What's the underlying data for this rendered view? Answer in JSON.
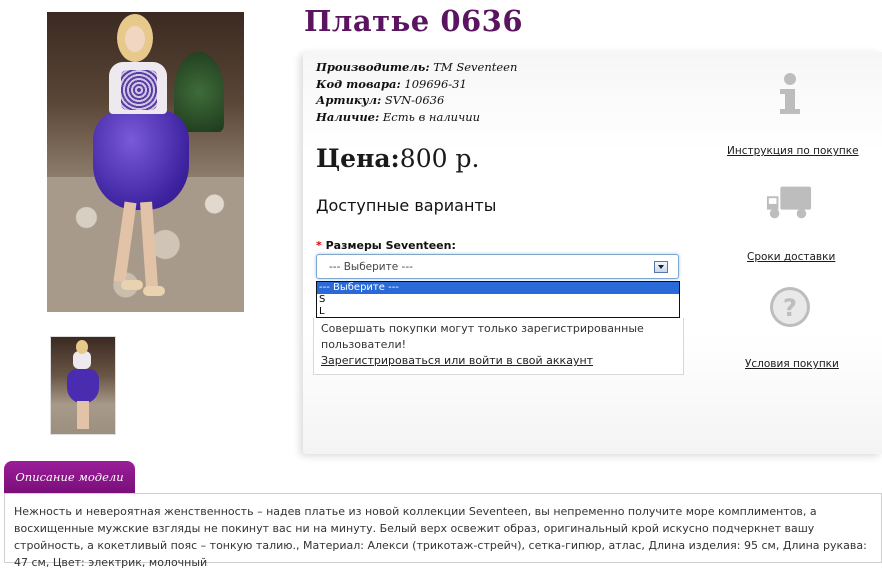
{
  "product": {
    "title": "Платье 0636",
    "meta": [
      {
        "label": "Производитель:",
        "value": "TM Seventeen"
      },
      {
        "label": "Код товара:",
        "value": "109696-31"
      },
      {
        "label": "Артикул:",
        "value": "SVN-0636"
      },
      {
        "label": "Наличие:",
        "value": "Есть в наличии"
      }
    ],
    "price_label": "Цена:",
    "price_value": "800 р."
  },
  "variants": {
    "title": "Доступные варианты",
    "required_mark": "*",
    "size_label": "Размеры Seventeen:",
    "selected": "--- Выберите ---",
    "options": [
      "--- Выберите ---",
      "S",
      "L"
    ]
  },
  "notice": {
    "text": "Совершать покупки могут только зарегистрированные пользователи!",
    "link": "Зарегистрироваться или войти в свой аккаунт"
  },
  "side_links": [
    {
      "icon": "info-icon",
      "label": "Инструкция по покупке"
    },
    {
      "icon": "truck-icon",
      "label": "Сроки доставки"
    },
    {
      "icon": "question-icon",
      "label": "Условия покупки"
    }
  ],
  "description": {
    "tab_label": "Описание модели",
    "text": "Нежность и невероятная женственность – надев платье из новой коллекции Seventeen, вы непременно получите море комплиментов, а восхищенные мужские взгляды не покинут вас ни на минуту. Белый верх освежит образ, оригинальный крой искусно подчеркнет вашу стройность, а кокетливый пояс – тонкую талию., Материал: Алекси (трикотаж-стрейч), сетка-гипюр, атлас, Длина изделия: 95 см, Длина рукава: 47 см, Цвет: электрик, молочный"
  },
  "colors": {
    "title": "#5b1560",
    "tab": "#8a168a",
    "selected_option": "#2a6ad8"
  }
}
